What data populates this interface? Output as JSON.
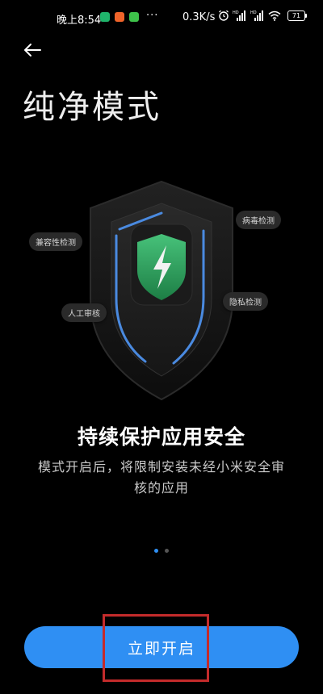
{
  "status_bar": {
    "time": "晚上8:54",
    "more": "···",
    "network_speed": "0.3K/s",
    "battery": "71",
    "icons": [
      "alarm-icon",
      "signal-hd-icon",
      "signal-hd-icon",
      "wifi-icon",
      "battery-icon"
    ],
    "app_icons": [
      {
        "name": "app-notification-icon-green",
        "color": "#1fb46b"
      },
      {
        "name": "app-notification-icon-orange",
        "color": "#f0642a"
      },
      {
        "name": "app-notification-icon-download",
        "color": "#3ec24a"
      }
    ]
  },
  "header": {
    "back_icon": "arrow-left-icon",
    "title": "纯净模式"
  },
  "illustration": {
    "shield_icon": "shield-lightning-icon",
    "tags": {
      "compat": "兼容性检测",
      "virus": "病毒检测",
      "manual": "人工审核",
      "privacy": "隐私检测"
    },
    "colors": {
      "shield_green": "#2fa35e",
      "shield_rim": "#4a8ae0",
      "outer_shield": "#1a1a1a"
    }
  },
  "content": {
    "headline": "持续保护应用安全",
    "description": "模式开启后，将限制安装未经小米安全审核的应用"
  },
  "pager": {
    "current": 1,
    "total": 2,
    "active_color": "#2f8ff3",
    "inactive_color": "#555555"
  },
  "action": {
    "button_label": "立即开启",
    "button_color": "#2f8ff3",
    "highlight_color": "#c42b2b"
  }
}
